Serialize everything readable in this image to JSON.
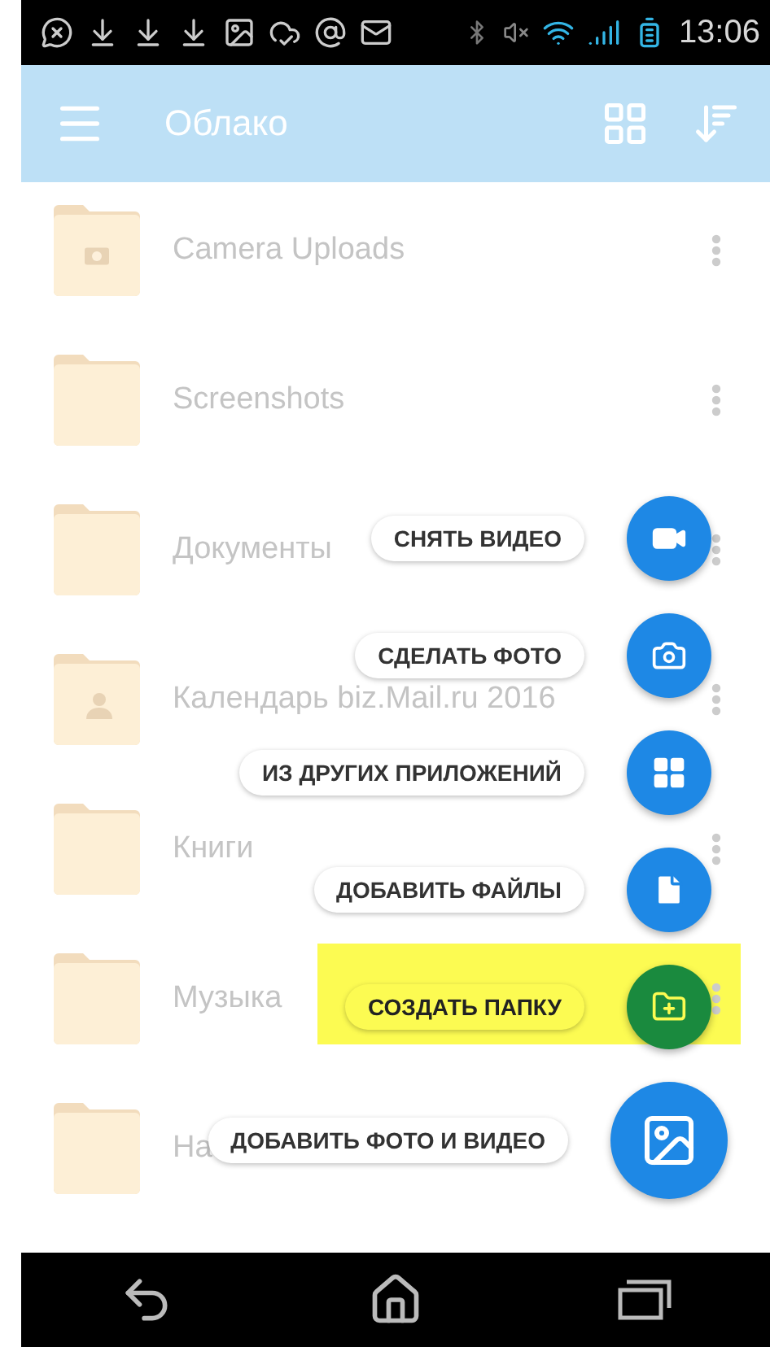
{
  "status_bar": {
    "time": "13:06"
  },
  "app_bar": {
    "title": "Облако"
  },
  "folders": [
    {
      "name": "Camera Uploads",
      "kind": "camera",
      "menu": true
    },
    {
      "name": "Screenshots",
      "kind": "plain",
      "menu": true
    },
    {
      "name": "Документы",
      "kind": "plain",
      "menu": true
    },
    {
      "name": "Календарь biz.Mail.ru 2016",
      "kind": "shared",
      "menu": true
    },
    {
      "name": "Книги",
      "kind": "plain",
      "menu": true
    },
    {
      "name": "Музыка",
      "kind": "plain",
      "menu": true
    },
    {
      "name": "На",
      "kind": "plain",
      "menu": false
    }
  ],
  "fab_menu": [
    {
      "label": "СНЯТЬ ВИДЕО",
      "kind": "video",
      "highlighted": false
    },
    {
      "label": "СДЕЛАТЬ ФОТО",
      "kind": "photo",
      "highlighted": false
    },
    {
      "label": "ИЗ ДРУГИХ ПРИЛОЖЕНИЙ",
      "kind": "apps",
      "highlighted": false
    },
    {
      "label": "ДОБАВИТЬ ФАЙЛЫ",
      "kind": "files",
      "highlighted": false
    },
    {
      "label": "СОЗДАТЬ ПАПКУ",
      "kind": "folder",
      "highlighted": true
    },
    {
      "label": "ДОБАВИТЬ ФОТО И ВИДЕО",
      "kind": "gallery",
      "highlighted": false
    }
  ]
}
